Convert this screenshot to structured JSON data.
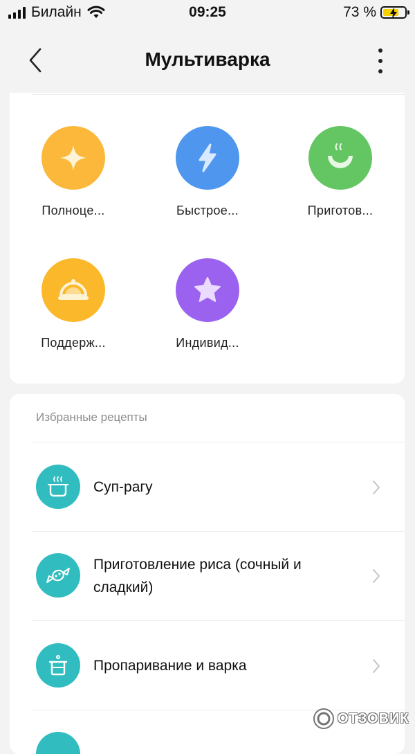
{
  "status_bar": {
    "carrier": "Билайн",
    "time": "09:25",
    "battery_percent": "73 %",
    "battery_level": 0.73
  },
  "header": {
    "title": "Мультиварка",
    "back_icon": "chevron-left-icon",
    "menu_icon": "more-vertical-icon"
  },
  "modes": [
    {
      "label": "Полноце...",
      "icon": "sparkle-icon",
      "color": "#fbb83b"
    },
    {
      "label": "Быстрое...",
      "icon": "lightning-icon",
      "color": "#4f97ee"
    },
    {
      "label": "Приготов...",
      "icon": "steaming-bowl-icon",
      "color": "#64c563"
    },
    {
      "label": "Поддерж...",
      "icon": "food-cloche-icon",
      "color": "#fbb82a"
    },
    {
      "label": "Индивид...",
      "icon": "star-icon",
      "color": "#9b62f0"
    }
  ],
  "recipes": {
    "section_title": "Избранные рецепты",
    "accent": "#31bdbf",
    "items": [
      {
        "label": "Суп-рагу",
        "icon": "soup-pot-icon"
      },
      {
        "label": "Приготовление риса (сочный и сладкий)",
        "icon": "candy-icon"
      },
      {
        "label": "Пропаривание и варка",
        "icon": "steamer-pot-icon"
      }
    ]
  },
  "watermark": {
    "text": "ОТЗОВИК"
  }
}
